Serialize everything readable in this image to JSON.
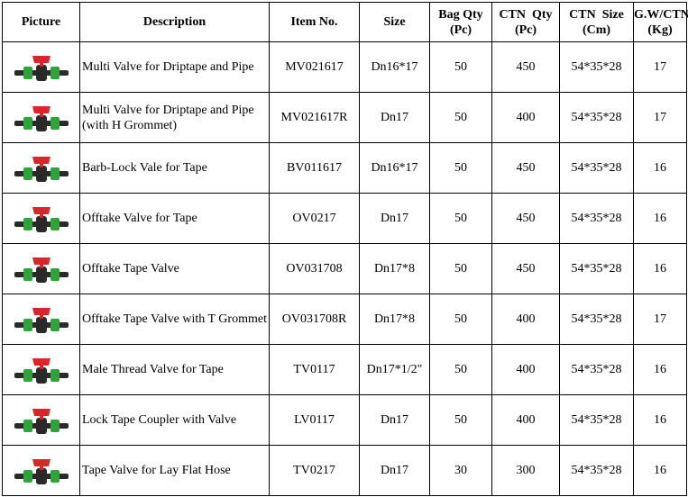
{
  "headers": {
    "picture": "Picture",
    "description": "Description",
    "item_no": "Item No.",
    "size": "Size",
    "bag_qty": [
      "Bag Qty",
      "(Pc)"
    ],
    "ctn_qty": [
      "CTN  Qty",
      "(Pc)"
    ],
    "ctn_size": [
      "CTN  Size",
      "(Cm)"
    ],
    "gw": [
      "G.W/CTN",
      "(Kg)"
    ]
  },
  "rows": [
    {
      "picture": "valve-icon",
      "description": "Multi Valve for Driptape and Pipe",
      "item_no": "MV021617",
      "size": "Dn16*17",
      "bag_qty": "50",
      "ctn_qty": "450",
      "ctn_size": "54*35*28",
      "gw": "17"
    },
    {
      "picture": "valve-icon",
      "description": "Multi Valve for Driptape and Pipe (with H Grommet)",
      "item_no": "MV021617R",
      "size": "Dn17",
      "bag_qty": "50",
      "ctn_qty": "400",
      "ctn_size": "54*35*28",
      "gw": "17"
    },
    {
      "picture": "valve-icon",
      "description": "Barb-Lock Vale for Tape",
      "item_no": "BV011617",
      "size": "Dn16*17",
      "bag_qty": "50",
      "ctn_qty": "450",
      "ctn_size": "54*35*28",
      "gw": "16"
    },
    {
      "picture": "valve-icon",
      "description": "Offtake Valve for Tape",
      "item_no": "OV0217",
      "size": "Dn17",
      "bag_qty": "50",
      "ctn_qty": "450",
      "ctn_size": "54*35*28",
      "gw": "16"
    },
    {
      "picture": "valve-icon",
      "description": "Offtake Tape Valve",
      "item_no": "OV031708",
      "size": "Dn17*8",
      "bag_qty": "50",
      "ctn_qty": "450",
      "ctn_size": "54*35*28",
      "gw": "16"
    },
    {
      "picture": "valve-icon",
      "description": "Offtake Tape Valve with T Grommet",
      "item_no": "OV031708R",
      "size": "Dn17*8",
      "bag_qty": "50",
      "ctn_qty": "400",
      "ctn_size": "54*35*28",
      "gw": "17"
    },
    {
      "picture": "valve-icon",
      "description": "Male Thread Valve for Tape",
      "item_no": "TV0117",
      "size": "Dn17*1/2\"",
      "bag_qty": "50",
      "ctn_qty": "400",
      "ctn_size": "54*35*28",
      "gw": "16"
    },
    {
      "picture": "valve-icon",
      "description": "Lock Tape Coupler with Valve",
      "item_no": "LV0117",
      "size": "Dn17",
      "bag_qty": "50",
      "ctn_qty": "400",
      "ctn_size": "54*35*28",
      "gw": "16"
    },
    {
      "picture": "valve-icon",
      "description": "Tape Valve for Lay Flat Hose",
      "item_no": "TV0217",
      "size": "Dn17",
      "bag_qty": "30",
      "ctn_qty": "300",
      "ctn_size": "54*35*28",
      "gw": "16"
    }
  ],
  "colors": {
    "handle": "#d9262a",
    "body": "#2a2a2a",
    "ring": "#2fa33a"
  }
}
